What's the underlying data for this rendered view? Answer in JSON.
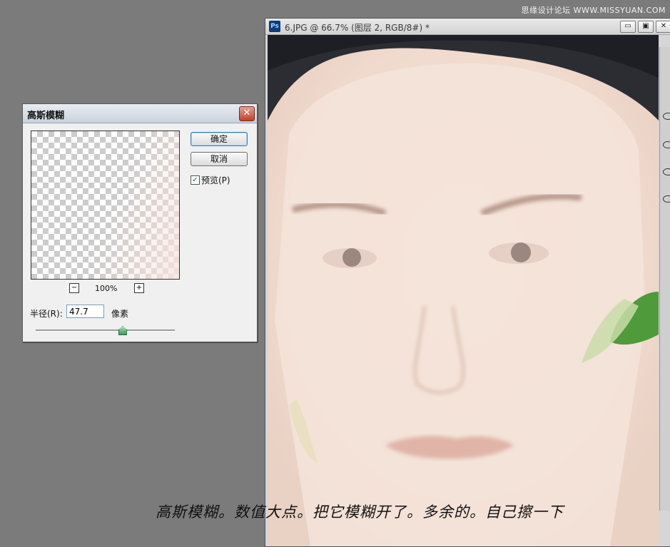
{
  "watermark": "思缘设计论坛 WWW.MISSYUAN.COM",
  "document": {
    "app_icon": "Ps",
    "title": "6.JPG @ 66.7% (图层 2, RGB/8#) *",
    "minimize": "▭",
    "restore": "▣",
    "close": "✕"
  },
  "caption": "高斯模糊。数值大点。把它模糊开了。多余的。自己擦一下",
  "dialog": {
    "title": "高斯模糊",
    "close": "✕",
    "ok_label": "确定",
    "cancel_label": "取消",
    "preview_checked": "✓",
    "preview_label": "预览(P)",
    "zoom_out": "−",
    "zoom_in": "+",
    "zoom_value": "100%",
    "radius_label": "半径(R):",
    "radius_value": "47.7",
    "unit_label": "像素",
    "slider_level": 0.62
  },
  "colors": {
    "background": "#7b7b7b",
    "dialog_bg": "#f0f0f0",
    "close_red": "#c2402a"
  }
}
